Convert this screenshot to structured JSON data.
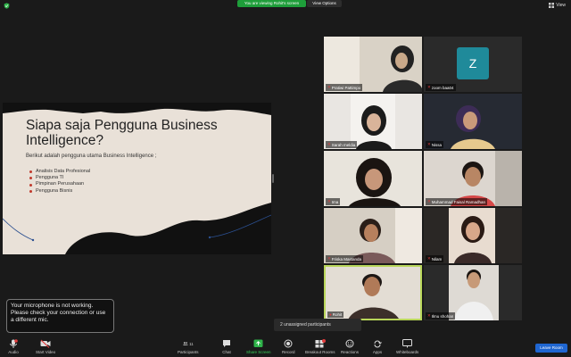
{
  "top": {
    "banner": "You are viewing Rohit's screen",
    "view_options": "View Options",
    "view_label": "View"
  },
  "slide": {
    "title": "Siapa saja Pengguna Business Intelligence?",
    "subtitle": "Berikut adalah pengguna utama Business Intelligence ;",
    "bullets": [
      "Analisis Data Profesional",
      "Pengguna TI",
      "Pimpinan Perusahaan",
      "Pengguna Bisnis"
    ]
  },
  "participants": [
    {
      "name": "Pratiwi Pattimpo"
    },
    {
      "name": "zoom baa04",
      "initial": "Z"
    },
    {
      "name": "Sarah meldia"
    },
    {
      "name": "Nissa"
    },
    {
      "name": "Ima"
    },
    {
      "name": "Muhammad Faisal Ramadhan"
    },
    {
      "name": "Friska Mastanda"
    },
    {
      "name": "Nilam"
    },
    {
      "name": "Rohit"
    },
    {
      "name": "Ilmu shohan"
    }
  ],
  "mic_warning": "Your microphone is not working. Please check your connection or use a different mic.",
  "unassigned": "2 unassigned participants",
  "toolbar": {
    "audio": "Audio",
    "start_video": "Start Video",
    "participants": "Participants",
    "participants_count": "11",
    "chat": "Chat",
    "share_screen": "Share Screen",
    "record": "Record",
    "breakout": "Breakout Rooms",
    "reactions": "Reactions",
    "apps": "Apps",
    "whiteboards": "Whiteboards",
    "leave": "Leave Room"
  },
  "colors": {
    "banner_green": "#1e9e3a",
    "leave_blue": "#1f66d1",
    "active_border": "#b9d65a",
    "slide_bg": "#e9e1d8"
  }
}
